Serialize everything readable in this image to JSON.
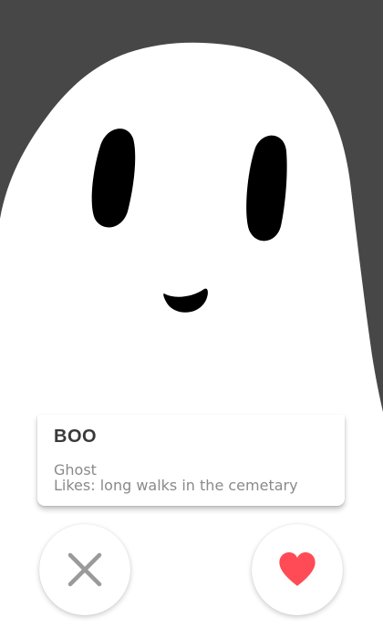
{
  "profile": {
    "name": "BOO",
    "species": "Ghost",
    "likes": "Likes: long walks in the cemetary"
  },
  "photo": {
    "subject": "ghost-illustration",
    "background_color": "#474747",
    "ghost_color": "#ffffff",
    "feature_color": "#000000"
  },
  "actions": {
    "dislike_icon": "close-icon",
    "like_icon": "heart-icon",
    "dislike_color": "#9a9a9a",
    "like_color": "#ff4b55"
  }
}
